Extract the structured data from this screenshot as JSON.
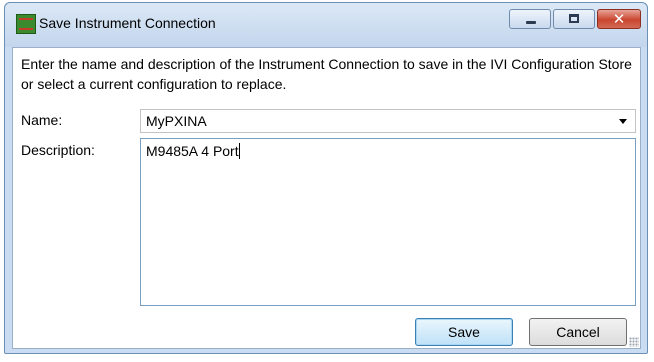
{
  "window": {
    "title": "Save Instrument Connection",
    "icon": "instrument-app-icon",
    "controls": {
      "minimize": "minimize-icon",
      "maximize": "maximize-icon",
      "close": "close-icon",
      "close_glyph": "✕"
    }
  },
  "instructions": "Enter the name and description of the Instrument Connection to save in the IVI Configuration Store or select a current configuration to replace.",
  "form": {
    "name_label": "Name:",
    "name_value": "MyPXINA",
    "description_label": "Description:",
    "description_value": "M9485A 4 Port"
  },
  "buttons": {
    "save": "Save",
    "cancel": "Cancel"
  },
  "colors": {
    "titlebar": "#c3d6ed",
    "close_button": "#c9452f",
    "default_button": "#bfe1f8"
  }
}
